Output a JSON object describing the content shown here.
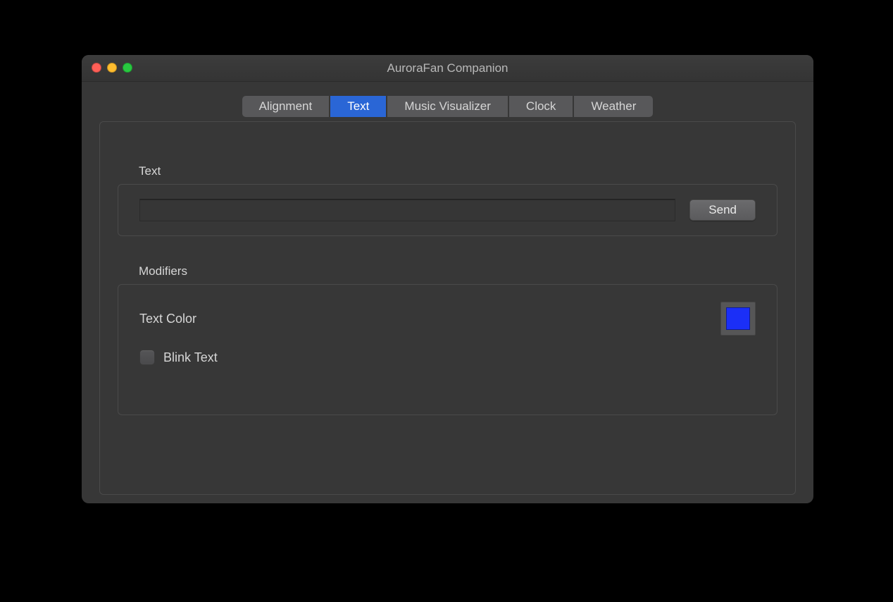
{
  "window": {
    "title": "AuroraFan Companion"
  },
  "tabs": [
    {
      "label": "Alignment",
      "active": false
    },
    {
      "label": "Text",
      "active": true
    },
    {
      "label": "Music Visualizer",
      "active": false
    },
    {
      "label": "Clock",
      "active": false
    },
    {
      "label": "Weather",
      "active": false
    }
  ],
  "textGroup": {
    "heading": "Text",
    "inputValue": "",
    "sendLabel": "Send"
  },
  "modifiers": {
    "heading": "Modifiers",
    "textColorLabel": "Text Color",
    "textColorValue": "#1b2ff7",
    "blinkLabel": "Blink Text",
    "blinkChecked": false
  }
}
